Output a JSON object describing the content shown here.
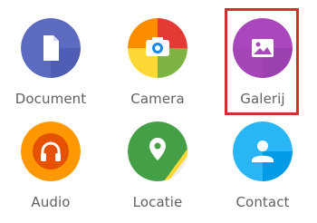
{
  "attachments": {
    "items": [
      {
        "id": "document",
        "label": "Document",
        "icon": "document-icon",
        "color": "#5c6bc0"
      },
      {
        "id": "camera",
        "label": "Camera",
        "icon": "camera-icon",
        "color": "#ef5350"
      },
      {
        "id": "gallery",
        "label": "Galerij",
        "icon": "gallery-icon",
        "color": "#ab47bc"
      },
      {
        "id": "audio",
        "label": "Audio",
        "icon": "headphones-icon",
        "color": "#ff9800"
      },
      {
        "id": "location",
        "label": "Locatie",
        "icon": "location-pin-icon",
        "color": "#43a047"
      },
      {
        "id": "contact",
        "label": "Contact",
        "icon": "contact-icon",
        "color": "#29b6f6"
      }
    ],
    "highlighted": "gallery",
    "highlight_color": "#d32f2f"
  }
}
